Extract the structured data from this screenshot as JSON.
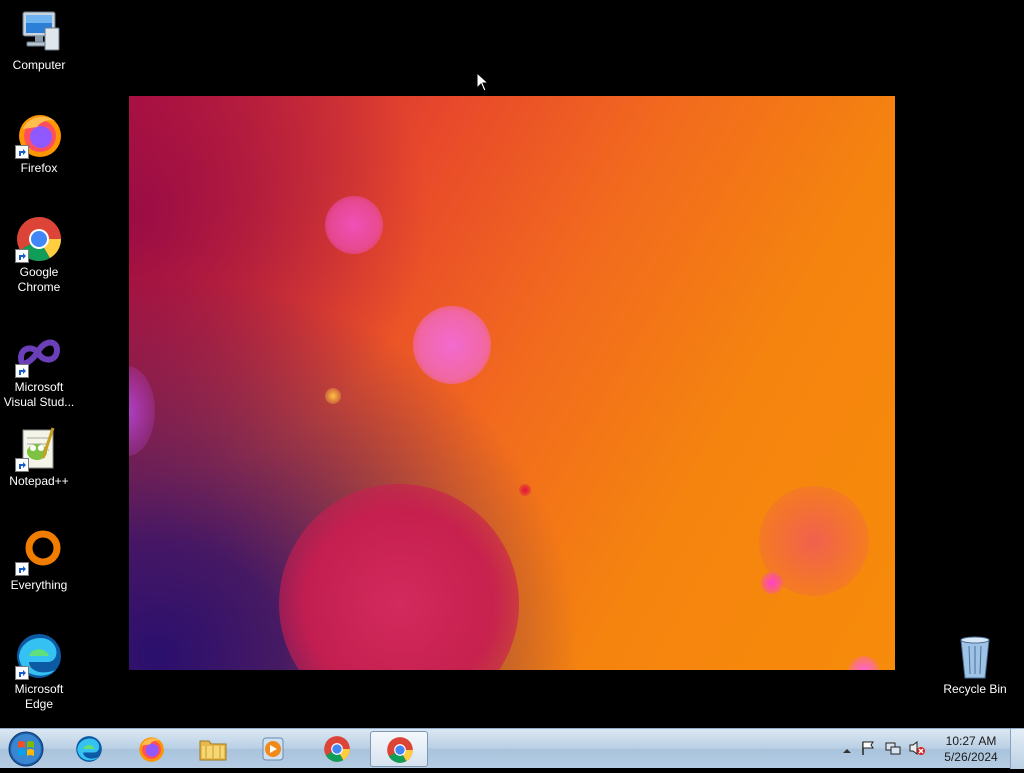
{
  "desktop": {
    "icons": [
      {
        "label": "Computer",
        "icon": "computer-icon"
      },
      {
        "label": "Firefox",
        "icon": "firefox-icon"
      },
      {
        "label": "Google Chrome",
        "icon": "chrome-icon"
      },
      {
        "label": "Microsoft Visual Stud...",
        "icon": "visual-studio-icon"
      },
      {
        "label": "Notepad++",
        "icon": "notepadpp-icon"
      },
      {
        "label": "Everything",
        "icon": "everything-icon"
      },
      {
        "label": "Microsoft Edge",
        "icon": "edge-icon"
      },
      {
        "label": "Recycle Bin",
        "icon": "recycle-bin-icon"
      }
    ]
  },
  "taskbar": {
    "start_icon": "windows-orb-icon",
    "pinned": [
      {
        "app": "Microsoft Edge",
        "icon": "edge-icon",
        "active": false
      },
      {
        "app": "Firefox",
        "icon": "firefox-icon",
        "active": false
      },
      {
        "app": "Windows Explorer",
        "icon": "folder-icon",
        "active": false
      },
      {
        "app": "Windows Media Player",
        "icon": "media-player-icon",
        "active": false
      },
      {
        "app": "Google Chrome",
        "icon": "chrome-icon",
        "active": false
      },
      {
        "app": "Google Chrome",
        "icon": "chrome-icon",
        "active": true
      }
    ],
    "tray": {
      "icons": [
        "show-hidden-icons-icon",
        "action-center-flag-icon",
        "network-icon",
        "volume-muted-icon"
      ],
      "time": "10:27 AM",
      "date": "5/26/2024"
    }
  },
  "colors": {
    "taskbar": "#b9cfe4",
    "wallpaper_orange": "#f5840f",
    "wallpaper_magenta": "#b7153f",
    "wallpaper_purple": "#2a0f6e"
  }
}
